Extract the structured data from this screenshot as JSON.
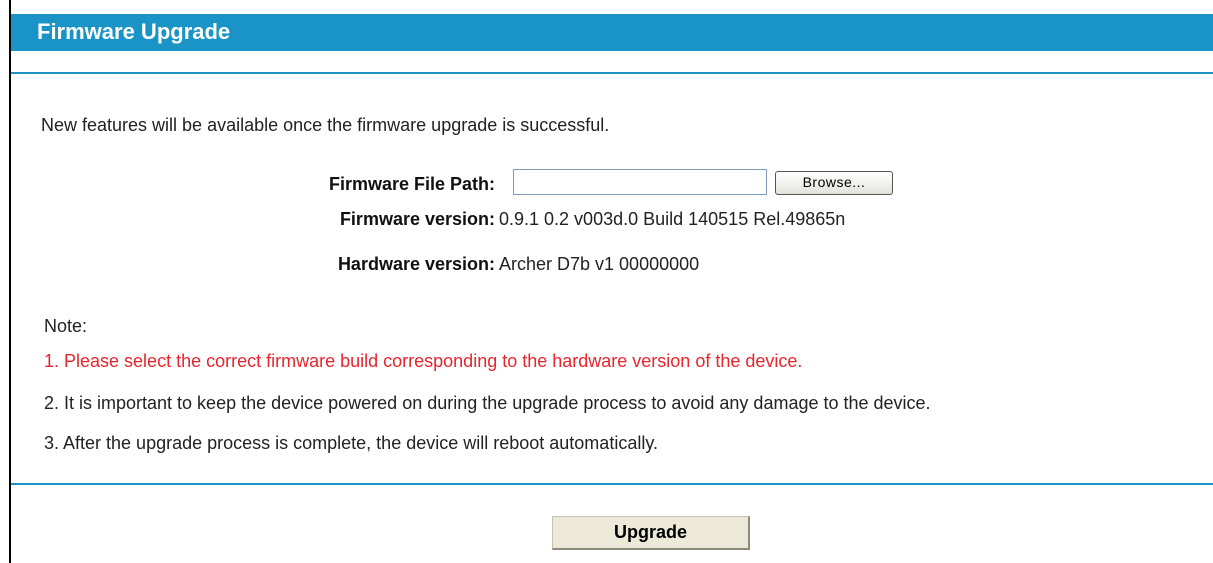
{
  "header": {
    "title": "Firmware Upgrade"
  },
  "intro": "New features will be available once the firmware upgrade is successful.",
  "fields": {
    "file_path_label": "Firmware File Path:",
    "file_path_value": "",
    "browse_label": "Browse...",
    "firmware_version_label": "Firmware version:",
    "firmware_version_value": "0.9.1 0.2 v003d.0 Build 140515 Rel.49865n",
    "hardware_version_label": "Hardware version:",
    "hardware_version_value": "Archer D7b v1 00000000"
  },
  "notes": {
    "label": "Note:",
    "items": [
      "1. Please select the correct firmware build corresponding to the hardware version of the device.",
      "2. It is important to keep the device powered on during the upgrade process to avoid any damage to the device.",
      "3. After the upgrade process is complete, the device will reboot automatically."
    ]
  },
  "actions": {
    "upgrade_label": "Upgrade"
  },
  "colors": {
    "accent": "#1a94c7",
    "warning_text": "#e8242c"
  }
}
